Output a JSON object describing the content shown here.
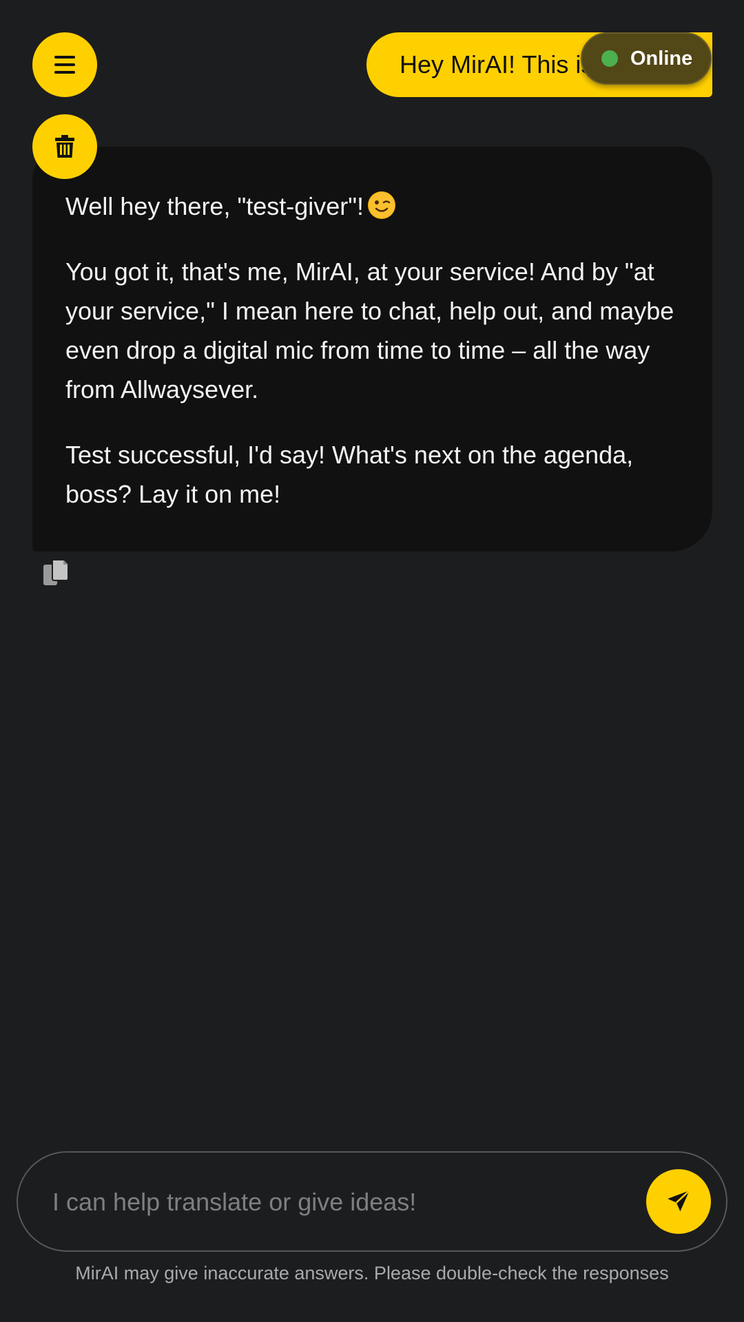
{
  "header": {
    "menu_icon": "hamburger-menu-icon",
    "delete_icon": "trash-icon"
  },
  "user_message": {
    "text": "Hey MirAI! This is a test"
  },
  "status": {
    "label": "Online",
    "dot_color": "#4caf50"
  },
  "assistant_message": {
    "paragraph_1": "Well hey there, \"test-giver\"!",
    "paragraph_1_emoji": "winking-face-emoji",
    "paragraph_2": "You got it, that's me, MirAI, at your service! And by \"at your service,\" I mean here to chat, help out, and maybe even drop a digital mic from time to time – all the way from Allwaysever.",
    "paragraph_3": "Test successful, I'd say! What's next on the agenda, boss? Lay it on me!",
    "copy_icon": "copy-icon"
  },
  "composer": {
    "placeholder": "I can help translate or give ideas!",
    "value": "",
    "send_icon": "send-paper-plane-icon"
  },
  "footer": {
    "disclaimer": "MirAI may give inaccurate answers. Please double-check the responses"
  },
  "colors": {
    "accent": "#ffd000",
    "background": "#1c1d1f",
    "assistant_bubble": "#111111"
  }
}
